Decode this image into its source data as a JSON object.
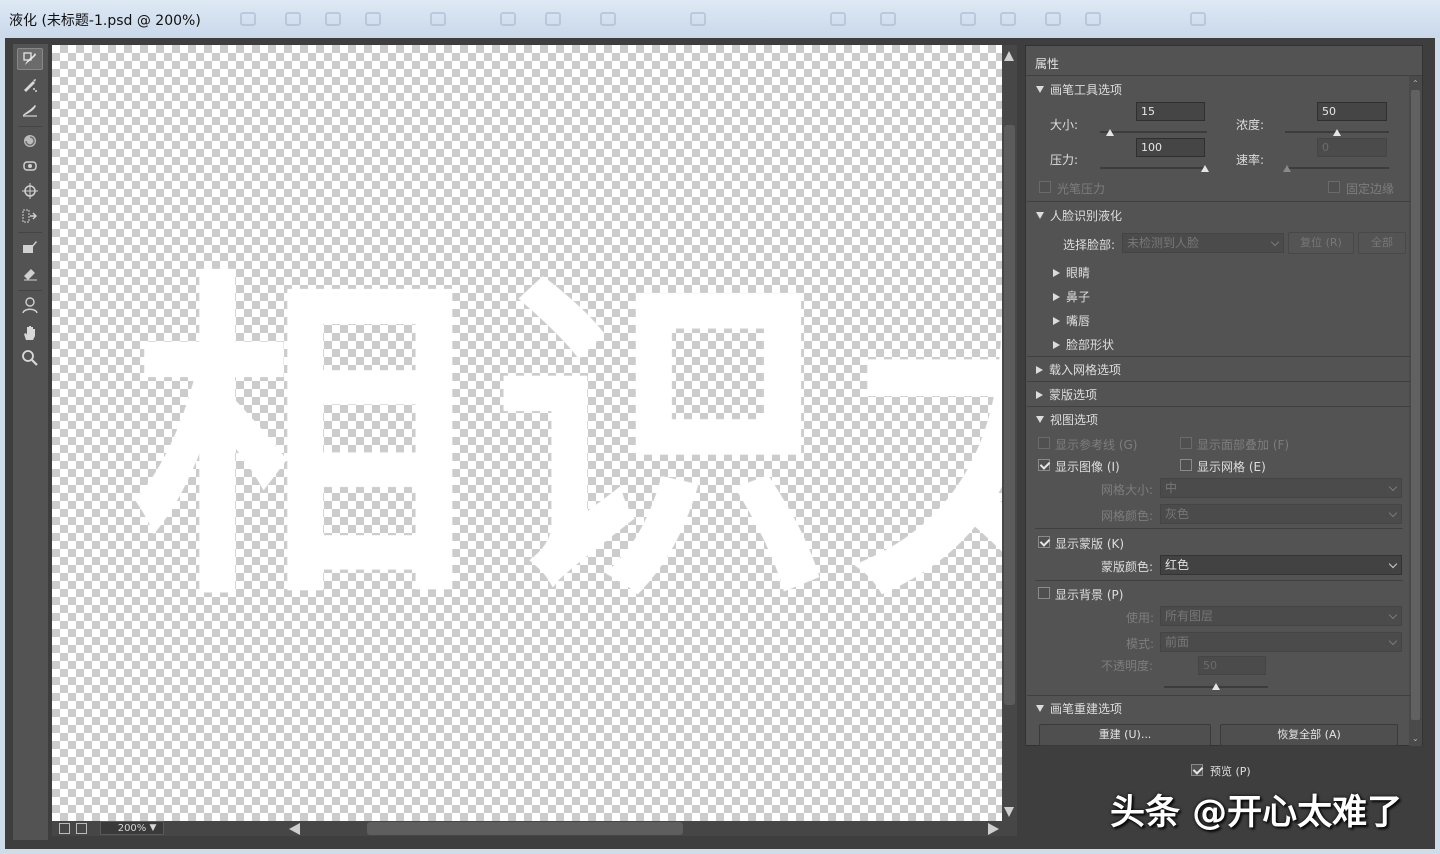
{
  "window": {
    "title": "液化 (未标题-1.psd @ 200%)"
  },
  "canvas": {
    "text": "相识太"
  },
  "status": {
    "zoom": "200%"
  },
  "panel": {
    "header": "属性",
    "brush_tool": {
      "title": "画笔工具选项",
      "size_label": "大小:",
      "size_value": "15",
      "size_level": 0.15,
      "density_label": "浓度:",
      "density_value": "50",
      "density_level": 0.5,
      "pressure_label": "压力:",
      "pressure_value": "100",
      "pressure_level": 1.0,
      "rate_label": "速率:",
      "rate_value": "0",
      "rate_level": 0.0,
      "stylus_label": "光笔压力",
      "pin_edges_label": "固定边缘"
    },
    "face": {
      "title": "人脸识别液化",
      "select_label": "选择脸部:",
      "select_value": "未检测到人脸",
      "reset_button": "复位 (R)",
      "all_button": "全部",
      "items": [
        "眼睛",
        "鼻子",
        "嘴唇",
        "脸部形状"
      ]
    },
    "load_mesh": "载入网格选项",
    "mask": "蒙版选项",
    "view": {
      "title": "视图选项",
      "show_guides": "显示参考线 (G)",
      "show_face_overlay": "显示面部叠加 (F)",
      "show_image": "显示图像 (I)",
      "show_mesh": "显示网格 (E)",
      "mesh_size_label": "网格大小:",
      "mesh_size_value": "中",
      "mesh_color_label": "网格颜色:",
      "mesh_color_value": "灰色",
      "show_mask": "显示蒙版 (K)",
      "mask_color_label": "蒙版颜色:",
      "mask_color_value": "红色",
      "show_backdrop": "显示背景 (P)",
      "use_label": "使用:",
      "use_value": "所有图层",
      "mode_label": "模式:",
      "mode_value": "前面",
      "opacity_label": "不透明度:",
      "opacity_value": "50",
      "opacity_level": 0.5
    },
    "reconstruct": {
      "title": "画笔重建选项",
      "reconstruct_button": "重建 (U)...",
      "restore_button": "恢复全部 (A)"
    }
  },
  "preview_label": "预览 (P)",
  "watermark": "头条 @开心太难了"
}
